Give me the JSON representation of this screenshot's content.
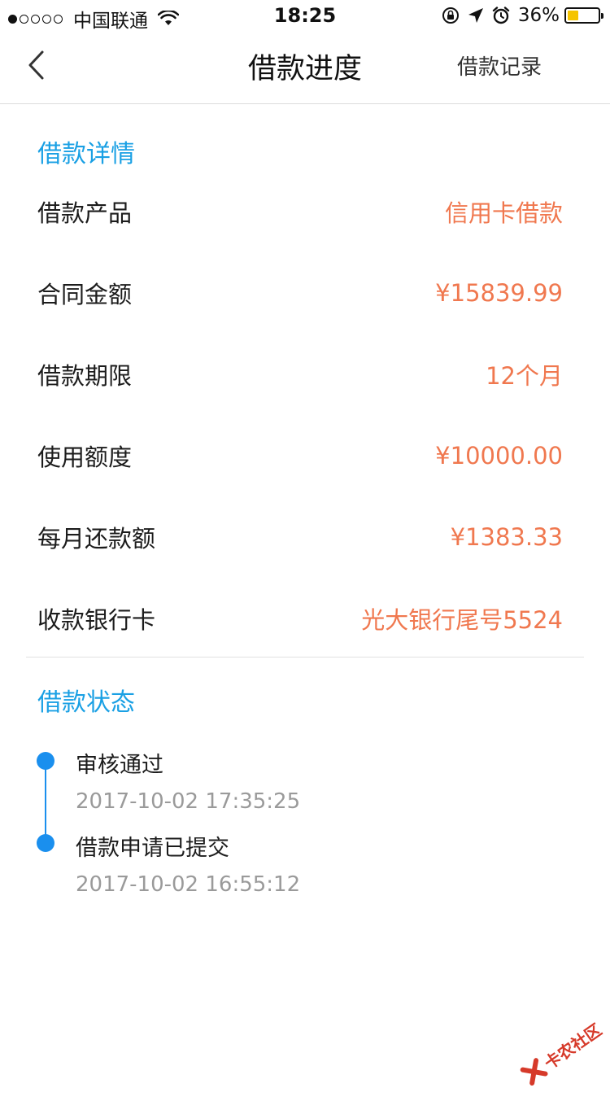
{
  "status_bar": {
    "carrier": "中国联通",
    "time": "18:25",
    "battery_percent": "36%",
    "battery_level": 0.36,
    "battery_color": "#f5c400",
    "signal_bars_filled": 1,
    "signal_bars_total": 5
  },
  "nav": {
    "back_icon": "chevron-left-icon",
    "title": "借款进度",
    "right_action": "借款记录"
  },
  "details": {
    "section_title": "借款详情",
    "rows": [
      {
        "label": "借款产品",
        "value": "信用卡借款"
      },
      {
        "label": "合同金额",
        "value": "¥15839.99"
      },
      {
        "label": "借款期限",
        "value": "12个月"
      },
      {
        "label": "使用额度",
        "value": "¥10000.00"
      },
      {
        "label": "每月还款额",
        "value": "¥1383.33"
      },
      {
        "label": "收款银行卡",
        "value": "光大银行尾号5524"
      }
    ]
  },
  "status": {
    "section_title": "借款状态",
    "events": [
      {
        "title": "审核通过",
        "time": "2017-10-02 17:35:25"
      },
      {
        "title": "借款申请已提交",
        "time": "2017-10-02 16:55:12"
      }
    ]
  },
  "watermark": {
    "text": "卡农社区"
  },
  "colors": {
    "accent_blue": "#1aa0e4",
    "timeline_blue": "#1a8fee",
    "value_orange": "#f0784f",
    "muted_gray": "#9a9a9a"
  }
}
